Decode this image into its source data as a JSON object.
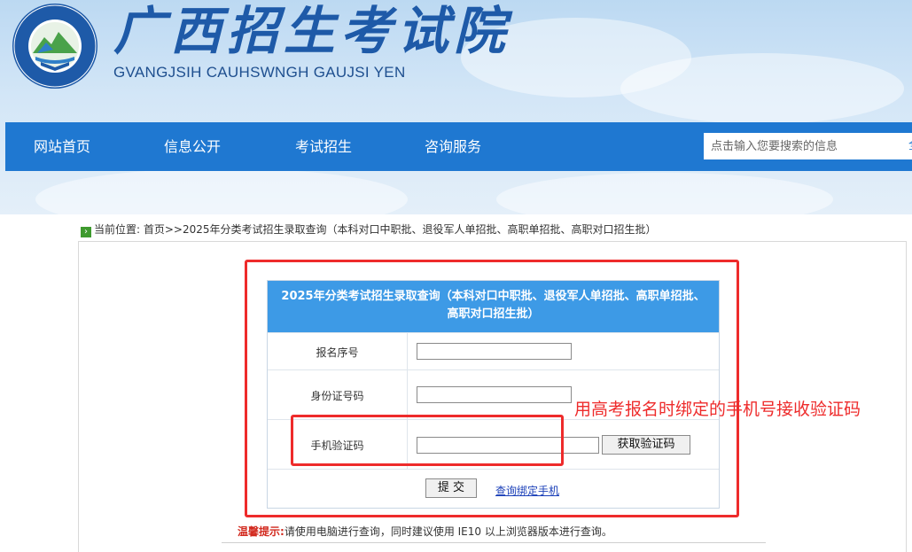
{
  "header": {
    "title": "广西招生考试院",
    "subtitle": "GVANGJSIH CAUHSWNGH GAUJSI YEN",
    "logo_ring_text": "广西招生考试院",
    "logo_ring_text_en": "GVANGJSIH CAUHSWNGH GAUJSI YEN"
  },
  "nav": {
    "items": [
      "网站首页",
      "信息公开",
      "考试招生",
      "咨询服务"
    ],
    "search_placeholder": "点击输入您要搜索的信息",
    "search_button": "全"
  },
  "breadcrumb": {
    "label": "当前位置:",
    "path": "首页>>2025年分类考试招生录取查询（本科对口中职批、退役军人单招批、高职单招批、高职对口招生批）"
  },
  "form": {
    "title": "2025年分类考试招生录取查询（本科对口中职批、退役军人单招批、高职单招批、高职对口招生批）",
    "fields": [
      {
        "label": "报名序号",
        "value": ""
      },
      {
        "label": "身份证号码",
        "value": ""
      },
      {
        "label": "手机验证码",
        "value": ""
      }
    ],
    "get_code_button": "获取验证码",
    "submit_button": "提 交",
    "bind_phone_link": "查询绑定手机"
  },
  "annotation": {
    "text": "用高考报名时绑定的手机号接收验证码",
    "color": "#ee2b2b"
  },
  "tip": {
    "label": "温馨提示:",
    "text": "请使用电脑进行查询，同时建议使用 IE10 以上浏览器版本进行查询。"
  },
  "colors": {
    "nav_bg": "#1f78d1",
    "form_header_bg": "#3d9ae6",
    "brand": "#1e5aa8"
  }
}
